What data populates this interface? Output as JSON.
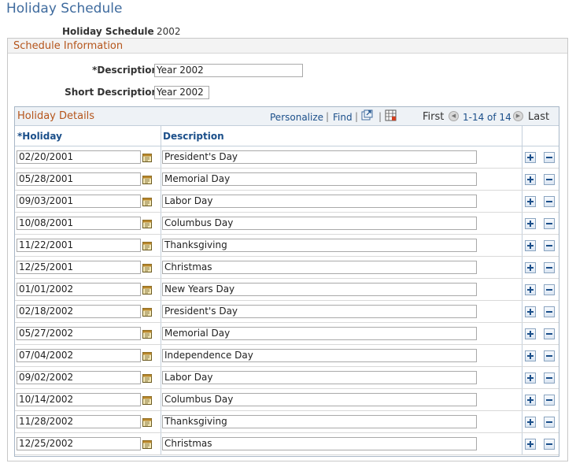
{
  "page": {
    "title": "Holiday Schedule"
  },
  "header": {
    "schedule_label": "Holiday Schedule",
    "schedule_value": "2002"
  },
  "schedule_info": {
    "section_title": "Schedule Information",
    "description_label": "*Description",
    "description_value": "Year 2002",
    "short_description_label": "Short Description",
    "short_description_value": "Year 2002"
  },
  "grid": {
    "title": "Holiday Details",
    "personalize": "Personalize",
    "find": "Find",
    "first": "First",
    "range": "1-14 of 14",
    "last": "Last",
    "columns": {
      "holiday": "*Holiday",
      "description": "Description"
    },
    "rows": [
      {
        "date": "02/20/2001",
        "description": "President's Day"
      },
      {
        "date": "05/28/2001",
        "description": "Memorial Day"
      },
      {
        "date": "09/03/2001",
        "description": "Labor Day"
      },
      {
        "date": "10/08/2001",
        "description": "Columbus Day"
      },
      {
        "date": "11/22/2001",
        "description": "Thanksgiving"
      },
      {
        "date": "12/25/2001",
        "description": "Christmas"
      },
      {
        "date": "01/01/2002",
        "description": "New Years Day"
      },
      {
        "date": "02/18/2002",
        "description": "President's Day"
      },
      {
        "date": "05/27/2002",
        "description": "Memorial Day"
      },
      {
        "date": "07/04/2002",
        "description": "Independence Day"
      },
      {
        "date": "09/02/2002",
        "description": "Labor Day"
      },
      {
        "date": "10/14/2002",
        "description": "Columbus Day"
      },
      {
        "date": "11/28/2002",
        "description": "Thanksgiving"
      },
      {
        "date": "12/25/2002",
        "description": "Christmas"
      }
    ]
  },
  "icons": {
    "calendar": "calendar-icon",
    "view_all": "new-window-icon",
    "download": "download-grid-icon",
    "add_row": "add-row-icon",
    "delete_row": "delete-row-icon"
  },
  "colors": {
    "title": "#3f6b9e",
    "section": "#b5551b",
    "link": "#1b4f8a"
  }
}
